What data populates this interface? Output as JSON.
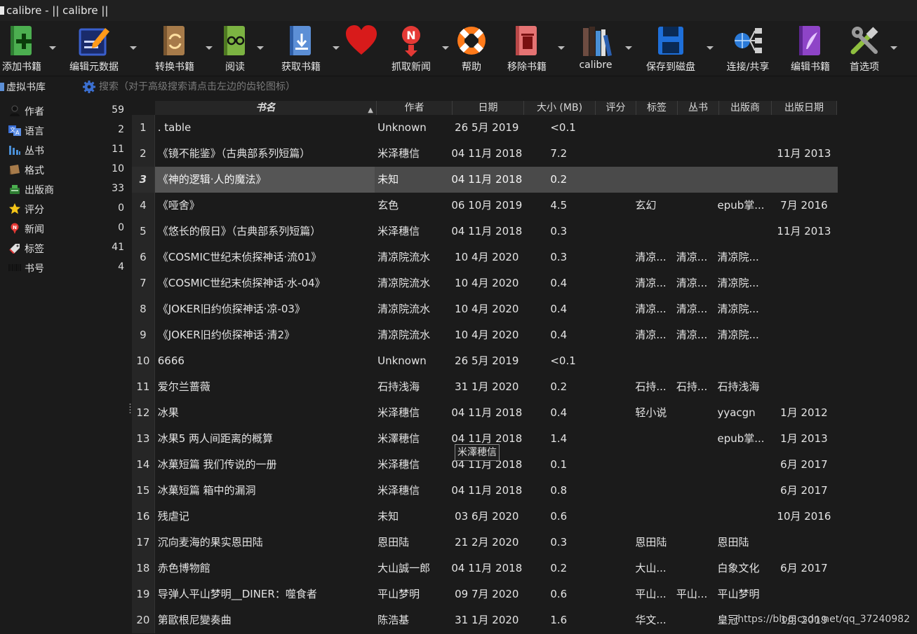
{
  "window": {
    "title": "calibre - || calibre ||"
  },
  "toolbar": {
    "buttons": [
      {
        "label": "添加书籍",
        "icon": "add-book-icon",
        "color": "#4caf50"
      },
      {
        "label": "编辑元数据",
        "icon": "edit-metadata-icon",
        "color": "#3a5fcd"
      },
      {
        "label": "转换书籍",
        "icon": "convert-book-icon",
        "color": "#a77b4a"
      },
      {
        "label": "阅读",
        "icon": "read-book-icon",
        "color": "#7cb342"
      },
      {
        "label": "获取书籍",
        "icon": "get-books-icon",
        "color": "#5c8fd6"
      },
      {
        "label": "",
        "icon": "heart-icon",
        "color": "#d81b1b"
      },
      {
        "label": "抓取新闻",
        "icon": "fetch-news-icon",
        "color": "#e53935"
      },
      {
        "label": "帮助",
        "icon": "help-lifebuoy-icon",
        "color": "#ff7a1a"
      },
      {
        "label": "移除书籍",
        "icon": "remove-book-icon",
        "color": "#e57373"
      },
      {
        "label": "calibre",
        "icon": "library-books-icon",
        "color": "#6d4c41"
      },
      {
        "label": "保存到磁盘",
        "icon": "save-disk-icon",
        "color": "#1e6fd9"
      },
      {
        "label": "连接/共享",
        "icon": "connect-share-icon",
        "color": "#2a7ad8"
      },
      {
        "label": "编辑书籍",
        "icon": "edit-book-icon",
        "color": "#8e44c7"
      },
      {
        "label": "首选项",
        "icon": "preferences-tools-icon",
        "color": "#8fbf3f"
      }
    ]
  },
  "virtual_library": {
    "label": "虚拟书库"
  },
  "search": {
    "placeholder": "搜索（对于高级搜索请点击左边的齿轮图标）"
  },
  "tag_browser": {
    "items": [
      {
        "label": "作者",
        "count": "59",
        "icon": "author-icon"
      },
      {
        "label": "语言",
        "count": "2",
        "icon": "language-icon"
      },
      {
        "label": "丛书",
        "count": "11",
        "icon": "series-icon"
      },
      {
        "label": "格式",
        "count": "10",
        "icon": "format-icon"
      },
      {
        "label": "出版商",
        "count": "33",
        "icon": "publisher-icon"
      },
      {
        "label": "评分",
        "count": "0",
        "icon": "rating-star-icon"
      },
      {
        "label": "新闻",
        "count": "0",
        "icon": "news-icon"
      },
      {
        "label": "标签",
        "count": "41",
        "icon": "tag-icon"
      },
      {
        "label": "书号",
        "count": "4",
        "icon": "isbn-icon"
      }
    ]
  },
  "book_list": {
    "columns": {
      "title": "书名",
      "author": "作者",
      "date": "日期",
      "size": "大小 (MB)",
      "rating": "评分",
      "tags": "标签",
      "series": "丛书",
      "publisher": "出版商",
      "pubdate": "出版日期"
    },
    "selected_row": 3,
    "rows": [
      {
        "n": "1",
        "title": ". table",
        "author": "Unknown",
        "date": "26 5月 2019",
        "size": "<0.1",
        "rating": "",
        "tags": "",
        "series": "",
        "publisher": "",
        "pubdate": ""
      },
      {
        "n": "2",
        "title": "《镜不能鉴》（古典部系列短篇）",
        "author": "米泽穗信",
        "date": "04 11月 2018",
        "size": "7.2",
        "rating": "",
        "tags": "",
        "series": "",
        "publisher": "",
        "pubdate": "11月 2013"
      },
      {
        "n": "3",
        "title": "《神的逻辑·人的魔法》",
        "author": "未知",
        "date": "04 11月 2018",
        "size": "0.2",
        "rating": "",
        "tags": "",
        "series": "",
        "publisher": "",
        "pubdate": ""
      },
      {
        "n": "4",
        "title": "《哑舍》",
        "author": "玄色",
        "date": "06 10月 2019",
        "size": "4.5",
        "rating": "",
        "tags": "玄幻",
        "series": "",
        "publisher": "epub掌...",
        "pubdate": "7月 2016"
      },
      {
        "n": "5",
        "title": "《悠长的假日》（古典部系列短篇）",
        "author": "米泽穗信",
        "date": "04 11月 2018",
        "size": "0.3",
        "rating": "",
        "tags": "",
        "series": "",
        "publisher": "",
        "pubdate": "11月 2013"
      },
      {
        "n": "6",
        "title": "《COSMIC世纪末侦探神话·流01》",
        "author": "清凉院流水",
        "date": "10 4月 2020",
        "size": "0.3",
        "rating": "",
        "tags": "清凉...",
        "series": "清凉...",
        "publisher": "清凉院...",
        "pubdate": ""
      },
      {
        "n": "7",
        "title": "《COSMIC世纪末侦探神话·水-04》",
        "author": "清凉院流水",
        "date": "10 4月 2020",
        "size": "0.4",
        "rating": "",
        "tags": "清凉...",
        "series": "清凉...",
        "publisher": "清凉院...",
        "pubdate": ""
      },
      {
        "n": "8",
        "title": "《JOKER旧约侦探神话·凉-03》",
        "author": "清凉院流水",
        "date": "10 4月 2020",
        "size": "0.4",
        "rating": "",
        "tags": "清凉...",
        "series": "清凉...",
        "publisher": "清凉院...",
        "pubdate": ""
      },
      {
        "n": "9",
        "title": "《JOKER旧约侦探神话·清2》",
        "author": "清凉院流水",
        "date": "10 4月 2020",
        "size": "0.4",
        "rating": "",
        "tags": "清凉...",
        "series": "清凉...",
        "publisher": "清凉院...",
        "pubdate": ""
      },
      {
        "n": "10",
        "title": "6666",
        "author": "Unknown",
        "date": "26 5月 2019",
        "size": "<0.1",
        "rating": "",
        "tags": "",
        "series": "",
        "publisher": "",
        "pubdate": ""
      },
      {
        "n": "11",
        "title": "爱尔兰蔷薇",
        "author": "石持浅海",
        "date": "31 1月 2020",
        "size": "0.2",
        "rating": "",
        "tags": "石持...",
        "series": "石持...",
        "publisher": "石持浅海",
        "pubdate": ""
      },
      {
        "n": "12",
        "title": "冰果",
        "author": "米泽穗信",
        "date": "04 11月 2018",
        "size": "0.4",
        "rating": "",
        "tags": "轻小说",
        "series": "",
        "publisher": "yyacgn",
        "pubdate": "1月 2012"
      },
      {
        "n": "13",
        "title": "冰果5 两人间距离的概算",
        "author": "米澤穂信",
        "date": "04 11月 2018",
        "size": "1.4",
        "rating": "",
        "tags": "",
        "series": "",
        "publisher": "epub掌...",
        "pubdate": "1月 2013"
      },
      {
        "n": "14",
        "title": "冰菓短篇 我们传说的一册",
        "author": "米泽穗信",
        "date": "04 11月 2018",
        "size": "0.1",
        "rating": "",
        "tags": "",
        "series": "",
        "publisher": "",
        "pubdate": "6月 2017"
      },
      {
        "n": "15",
        "title": "冰菓短篇 箱中的漏洞",
        "author": "米泽穗信",
        "date": "04 11月 2018",
        "size": "0.8",
        "rating": "",
        "tags": "",
        "series": "",
        "publisher": "",
        "pubdate": "6月 2017"
      },
      {
        "n": "16",
        "title": "残虐记",
        "author": "未知",
        "date": "03 6月 2020",
        "size": "0.6",
        "rating": "",
        "tags": "",
        "series": "",
        "publisher": "",
        "pubdate": "10月 2016"
      },
      {
        "n": "17",
        "title": "沉向麦海的果实恩田陆",
        "author": "恩田陆",
        "date": "21 2月 2020",
        "size": "0.3",
        "rating": "",
        "tags": "恩田陆",
        "series": "",
        "publisher": "恩田陆",
        "pubdate": ""
      },
      {
        "n": "18",
        "title": "赤色博物館",
        "author": "大山誠一郎",
        "date": "04 11月 2018",
        "size": "0.2",
        "rating": "",
        "tags": "大山...",
        "series": "",
        "publisher": "白象文化",
        "pubdate": "6月 2017"
      },
      {
        "n": "19",
        "title": "导弹人平山梦明__DINER：噬食者",
        "author": "平山梦明",
        "date": "09 7月 2020",
        "size": "0.6",
        "rating": "",
        "tags": "平山...",
        "series": "平山...",
        "publisher": "平山梦明",
        "pubdate": ""
      },
      {
        "n": "20",
        "title": "第歐根尼變奏曲",
        "author": "陈浩基",
        "date": "31 1月 2020",
        "size": "1.6",
        "rating": "",
        "tags": "华文...",
        "series": "",
        "publisher": "皇冠",
        "pubdate": "1月 2019"
      }
    ]
  },
  "tooltip": {
    "text": "米澤穂信"
  },
  "watermark": {
    "text": "https://blog.csdn.net/qq_37240982"
  }
}
